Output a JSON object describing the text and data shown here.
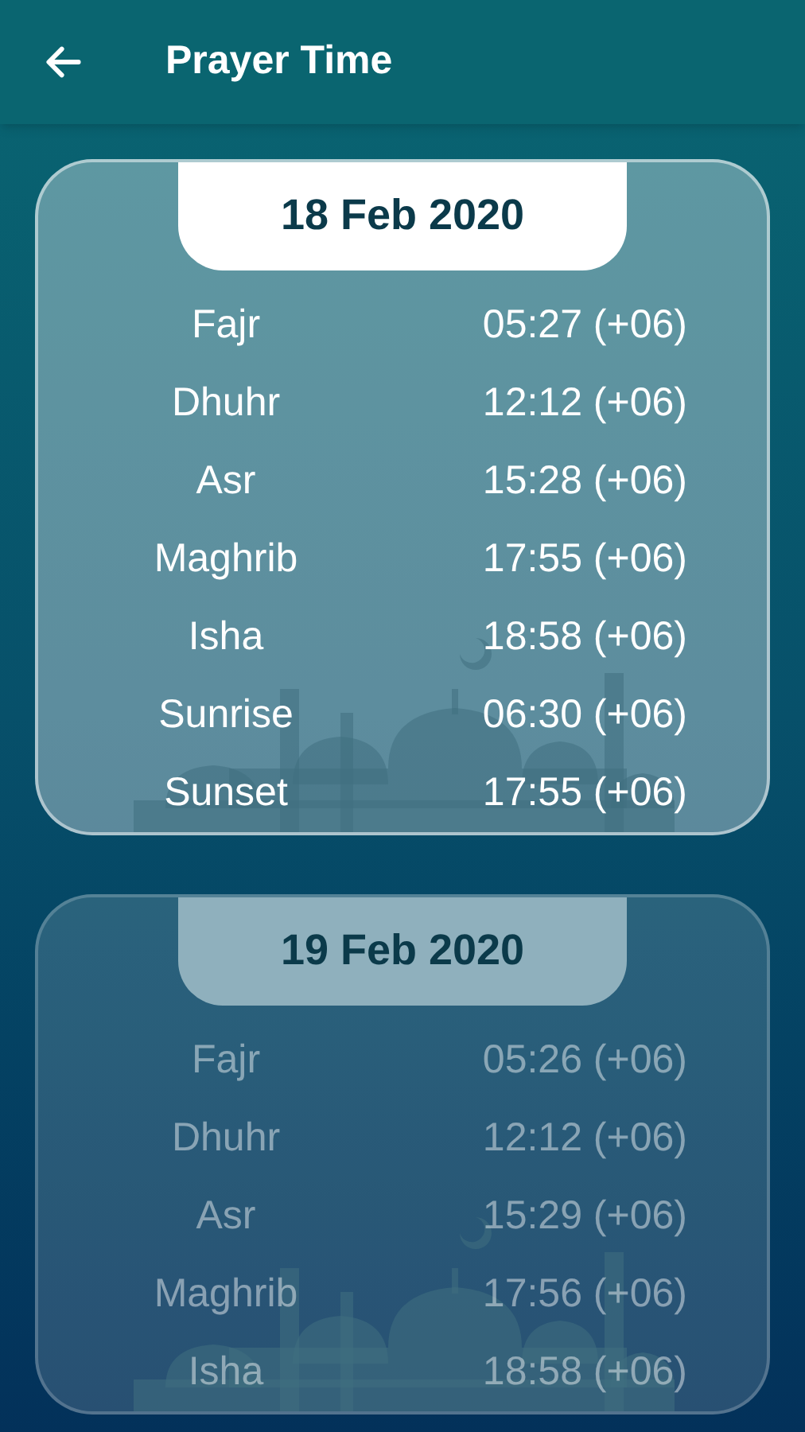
{
  "header": {
    "title": "Prayer Time"
  },
  "days": [
    {
      "date": "18 Feb 2020",
      "selected": true,
      "times": [
        {
          "name": "Fajr",
          "time": "05:27 (+06)"
        },
        {
          "name": "Dhuhr",
          "time": "12:12 (+06)"
        },
        {
          "name": "Asr",
          "time": "15:28 (+06)"
        },
        {
          "name": "Maghrib",
          "time": "17:55 (+06)"
        },
        {
          "name": "Isha",
          "time": "18:58 (+06)"
        },
        {
          "name": "Sunrise",
          "time": "06:30 (+06)"
        },
        {
          "name": "Sunset",
          "time": "17:55 (+06)"
        }
      ]
    },
    {
      "date": "19 Feb 2020",
      "selected": false,
      "times": [
        {
          "name": "Fajr",
          "time": "05:26 (+06)"
        },
        {
          "name": "Dhuhr",
          "time": "12:12 (+06)"
        },
        {
          "name": "Asr",
          "time": "15:29 (+06)"
        },
        {
          "name": "Maghrib",
          "time": "17:56 (+06)"
        },
        {
          "name": "Isha",
          "time": "18:58 (+06)"
        }
      ]
    }
  ]
}
